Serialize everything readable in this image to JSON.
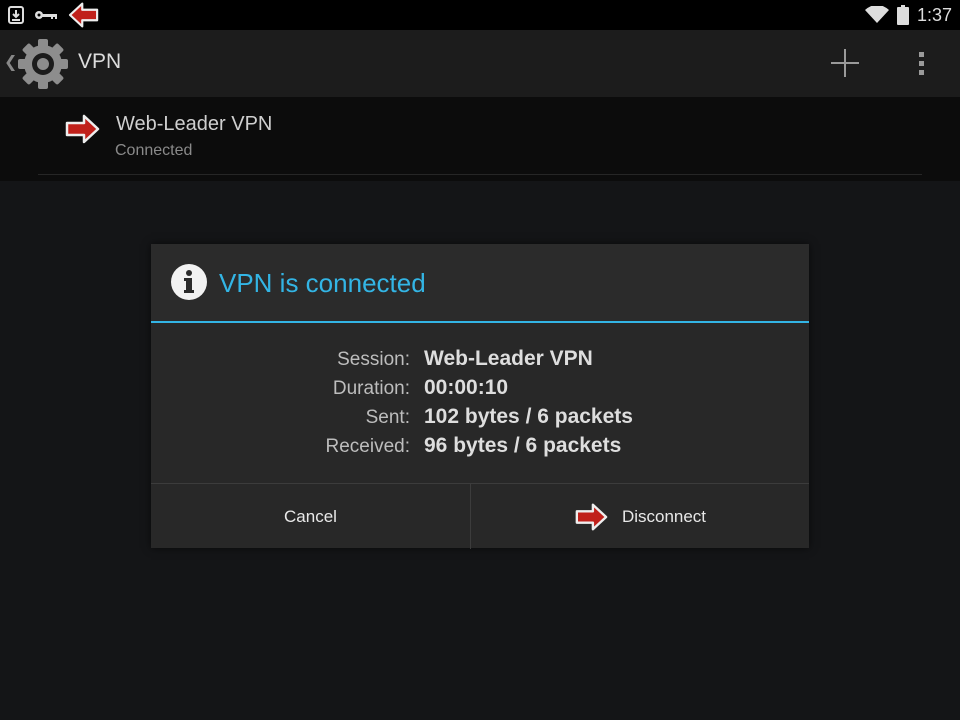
{
  "status_bar": {
    "time": "1:37",
    "icons": [
      "download-notification-icon",
      "vpn-key-icon",
      "vpn-arrow-notification-icon",
      "wifi-icon",
      "battery-icon"
    ]
  },
  "action_bar": {
    "up_glyph": "❮",
    "title": "VPN",
    "icons": [
      "settings-gear-icon",
      "add-icon",
      "overflow-menu-icon"
    ]
  },
  "vpn_list": {
    "items": [
      {
        "name": "Web-Leader VPN",
        "status": "Connected",
        "icon": "vpn-arrow-icon"
      }
    ]
  },
  "dialog": {
    "title": "VPN is connected",
    "icon": "info-icon",
    "rows": [
      {
        "label": "Session:",
        "value": "Web-Leader VPN"
      },
      {
        "label": "Duration:",
        "value": "00:00:10"
      },
      {
        "label": "Sent:",
        "value": "102 bytes / 6 packets"
      },
      {
        "label": "Received:",
        "value": "96 bytes / 6 packets"
      }
    ],
    "cancel_label": "Cancel",
    "disconnect_label": "Disconnect"
  },
  "colors": {
    "accent": "#33b5e5",
    "arrow_red": "#c0201a",
    "background": "#101214",
    "dialog_bg": "#282828"
  }
}
